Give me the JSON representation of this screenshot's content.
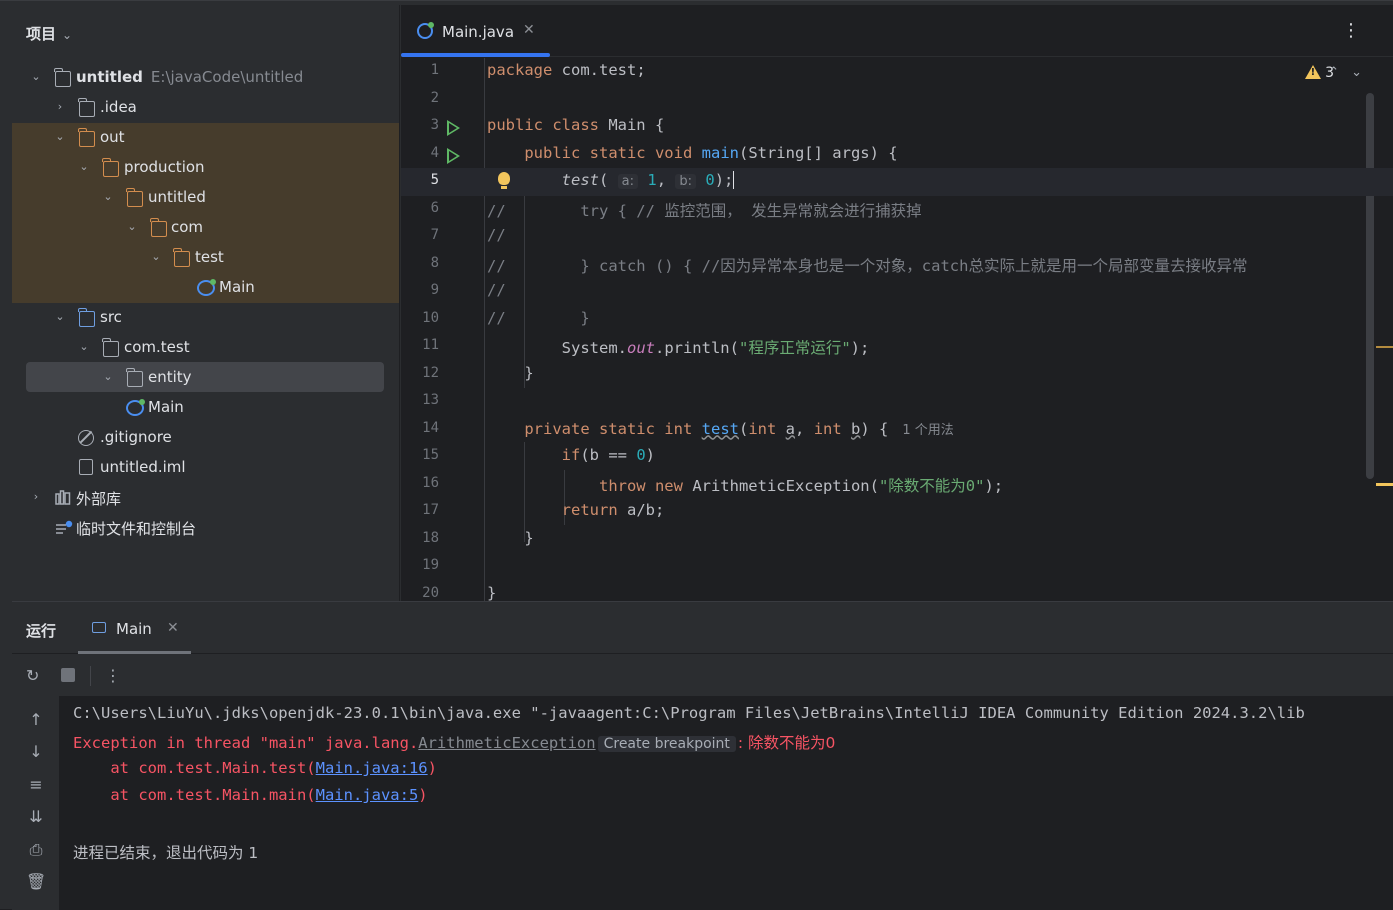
{
  "project": {
    "header": "项目",
    "root_name": "untitled",
    "root_path": "E:\\javaCode\\untitled",
    "items": [
      {
        "label": "untitled"
      },
      {
        "label": ".idea"
      },
      {
        "label": "out"
      },
      {
        "label": "production"
      },
      {
        "label": "untitled"
      },
      {
        "label": "com"
      },
      {
        "label": "test"
      },
      {
        "label": "Main"
      },
      {
        "label": "src"
      },
      {
        "label": "com.test"
      },
      {
        "label": "entity"
      },
      {
        "label": "Main"
      },
      {
        "label": ".gitignore"
      },
      {
        "label": "untitled.iml"
      },
      {
        "label": "外部库"
      },
      {
        "label": "临时文件和控制台"
      }
    ]
  },
  "editor": {
    "tab_label": "Main.java",
    "tab_close": "✕",
    "more": "⋮",
    "warning_count": "3",
    "line_numbers": [
      "1",
      "2",
      "3",
      "4",
      "5",
      "6",
      "7",
      "8",
      "9",
      "10",
      "11",
      "12",
      "13",
      "14",
      "15",
      "16",
      "17",
      "18",
      "19",
      "20"
    ],
    "current_line": "5",
    "usage_hint": "1 个用法",
    "param_hint_a": "a:",
    "param_hint_b": "b:"
  },
  "run": {
    "title": "运行",
    "tab_label": "Main",
    "tab_close": "✕",
    "console": {
      "cmd": "C:\\Users\\LiuYu\\.jdks\\openjdk-23.0.1\\bin\\java.exe \"-javaagent:C:\\Program Files\\JetBrains\\IntelliJ IDEA Community Edition 2024.3.2\\lib",
      "exc_prefix": "Exception in thread \"main\" java.lang.",
      "exc_class": "ArithmeticException",
      "chip": "Create breakpoint",
      "exc_msg": ": 除数不能为0",
      "at1_prefix": "    at com.test.Main.test(",
      "at1_link": "Main.java:16",
      "at2_prefix": "    at com.test.Main.main(",
      "at2_link": "Main.java:5",
      "close_paren": ")",
      "exit": "进程已结束，退出代码为 1"
    }
  },
  "colors": {
    "keyword": "#cf8e6d",
    "function": "#56a8f5",
    "string": "#6aab73",
    "number": "#2aacb8",
    "error": "#f75464",
    "accent": "#3574f0"
  }
}
